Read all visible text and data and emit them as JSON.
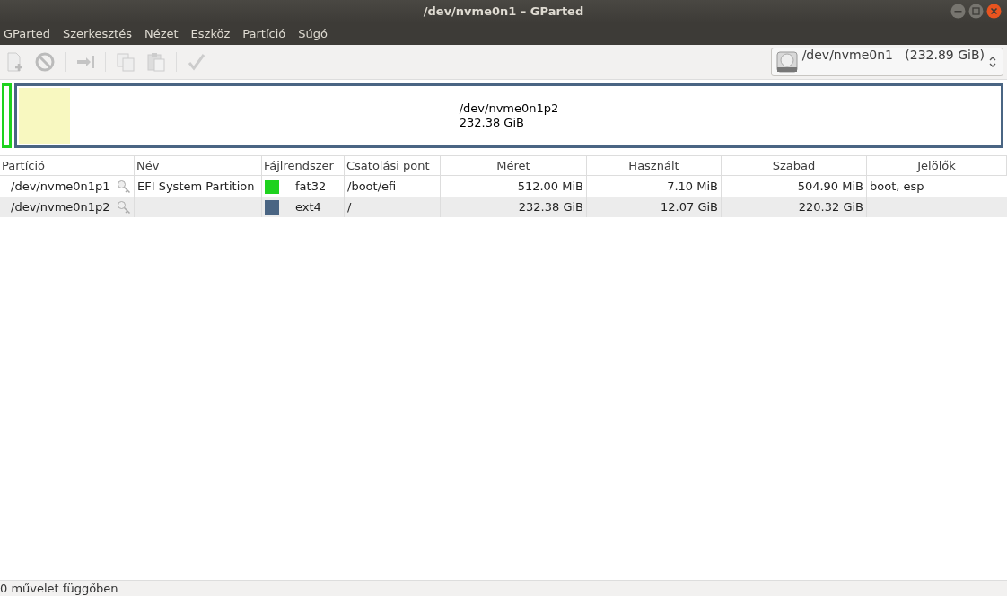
{
  "window": {
    "title": "/dev/nvme0n1 – GParted"
  },
  "menu": [
    "GParted",
    "Szerkesztés",
    "Nézet",
    "Eszköz",
    "Partíció",
    "Súgó"
  ],
  "device_selector": {
    "value": "/dev/nvme0n1   (232.89 GiB)"
  },
  "partition_map": [
    {
      "kind": "sliver",
      "color": "#1ed21e"
    },
    {
      "kind": "full",
      "label": "/dev/nvme0n1p2",
      "size": "232.38 GiB",
      "color": "#4a6583",
      "level": 0.052
    }
  ],
  "table": {
    "columns": [
      "Partíció",
      "Név",
      "Fájlrendszer",
      "Csatolási pont",
      "Méret",
      "Használt",
      "Szabad",
      "Jelölők"
    ],
    "rows": [
      {
        "partition": "/dev/nvme0n1p1",
        "name": "EFI System Partition",
        "color": "#1ed21e",
        "filesystem": "fat32",
        "mount": "/boot/efi",
        "size": "512.00 MiB",
        "used": "7.10 MiB",
        "free": "504.90 MiB",
        "flags": "boot, esp"
      },
      {
        "partition": "/dev/nvme0n1p2",
        "name": "",
        "color": "#4a6583",
        "filesystem": "ext4",
        "mount": "/",
        "size": "232.38 GiB",
        "used": "12.07 GiB",
        "free": "220.32 GiB",
        "flags": ""
      }
    ]
  },
  "status_bar": "0 művelet függőben"
}
